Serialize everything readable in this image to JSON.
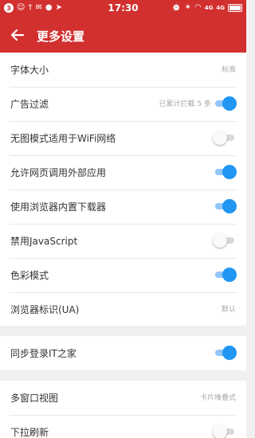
{
  "status_bar": {
    "notification_count": "3",
    "time": "17:30",
    "network_1": "4G",
    "network_2": "4G",
    "icons_left": [
      "people-icon",
      "usb-icon",
      "mail-icon",
      "chat-icon",
      "location-icon"
    ],
    "icons_right": [
      "alarm-icon",
      "bluetooth-icon",
      "wifi-icon",
      "signal-icon",
      "battery-icon"
    ]
  },
  "header": {
    "title": "更多设置"
  },
  "settings": {
    "font_size": {
      "label": "字体大小",
      "value": "标准"
    },
    "ad_filter": {
      "label": "广告过滤",
      "hint": "已累计拦截 5 条",
      "enabled": true
    },
    "no_image_wifi": {
      "label": "无图模式适用于WiFi网络",
      "enabled": false
    },
    "allow_external_apps": {
      "label": "允许网页调用外部应用",
      "enabled": true
    },
    "builtin_downloader": {
      "label": "使用浏览器内置下载器",
      "enabled": true
    },
    "disable_js": {
      "label": "禁用JavaScript",
      "enabled": false
    },
    "color_mode": {
      "label": "色彩模式",
      "enabled": true
    },
    "user_agent": {
      "label": "浏览器标识(UA)",
      "value": "默认"
    },
    "sync_login": {
      "label": "同步登录IT之家",
      "enabled": true
    },
    "multi_window": {
      "label": "多窗口视图",
      "value": "卡片堆叠式"
    },
    "pull_refresh": {
      "label": "下拉刷新",
      "enabled": false
    }
  },
  "colors": {
    "accent_red": "#d22f2f",
    "toggle_on": "#2196f3"
  }
}
